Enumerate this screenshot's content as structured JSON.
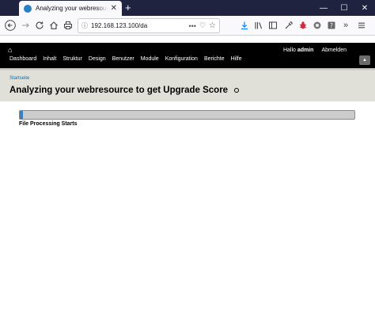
{
  "browser": {
    "tab_title": "Analyzing your webresource to get Upgrade Score",
    "tab_close": "✕",
    "new_tab": "+",
    "url": "192.168.123.100/da",
    "window_controls": {
      "minimize": "—",
      "maximize": "☐",
      "close": "✕"
    },
    "toolbar_icons": [
      "back-icon",
      "forward-icon",
      "reload-icon",
      "home-icon",
      "print-icon",
      "download-icon",
      "library-icon",
      "sidebar-icon",
      "eyedropper-icon",
      "bug-icon",
      "extension-icon",
      "help-icon",
      "overflow-icon",
      "menu-icon"
    ]
  },
  "admin_toolbar": {
    "home_icon": "⌂",
    "menu": [
      "Dashboard",
      "Inhalt",
      "Struktur",
      "Design",
      "Benutzer",
      "Module",
      "Konfiguration",
      "Berichte",
      "Hilfe"
    ],
    "greeting": "Hallo",
    "username": "admin",
    "logout": "Abmelden",
    "toggle": "▲"
  },
  "page": {
    "breadcrumb": "Startseite",
    "title": "Analyzing your webresource to get Upgrade Score"
  },
  "progress": {
    "percent": 1,
    "message": "File Processing Starts"
  },
  "colors": {
    "titlebar": "#202340",
    "accent": "#0071b8",
    "progress_fill": "#3580c6"
  }
}
